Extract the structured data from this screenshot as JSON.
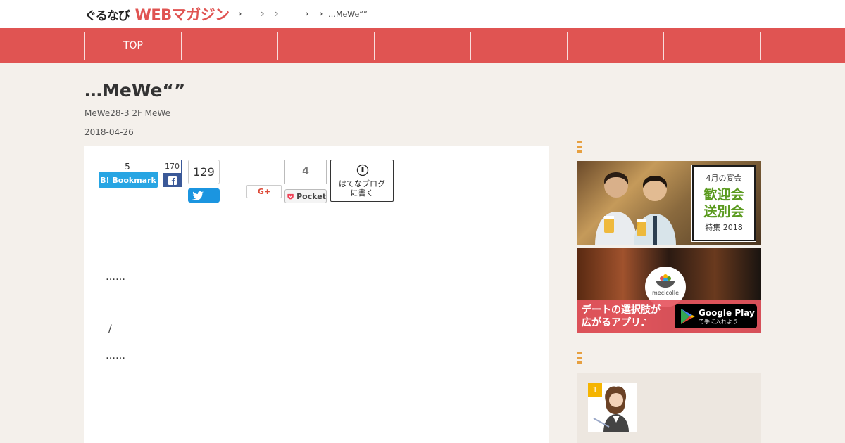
{
  "header": {
    "logo_left": "ぐるなび",
    "logo_right": "WEBマガジン",
    "breadcrumb_current": "…MeWe“”",
    "breadcrumb_separator": "›"
  },
  "nav": {
    "items": [
      "TOP",
      "",
      "",
      "",
      "",
      "",
      ""
    ]
  },
  "article": {
    "title": "…MeWe“”",
    "subtitle": "MeWe28-3 2F MeWe",
    "date": "2018-04-26",
    "paragraphs": [
      "……",
      "/",
      "……"
    ]
  },
  "share": {
    "hatena_count": "5",
    "hatena_label": "B! Bookmark",
    "facebook_count": "170",
    "twitter_count": "129",
    "google_label": "G+",
    "pocket_count": "4",
    "pocket_label": "Pocket",
    "hatena_blog_label": "はてなブログ\nに書く"
  },
  "sidebar": {
    "ad1": {
      "line1": "4月の宴会",
      "line2": "歓迎会\n送別会",
      "line3": "特集 2018"
    },
    "ad2": {
      "logo": "mecicolle",
      "caption": "デートの選択肢が\n広がるアプリ♪",
      "store_title": "Google Play",
      "store_sub": "で手に入れよう"
    },
    "ranking_first": "1"
  },
  "colors": {
    "brand_red": "#e05452",
    "accent_orange": "#e7a040",
    "background": "#f4f0eb"
  }
}
